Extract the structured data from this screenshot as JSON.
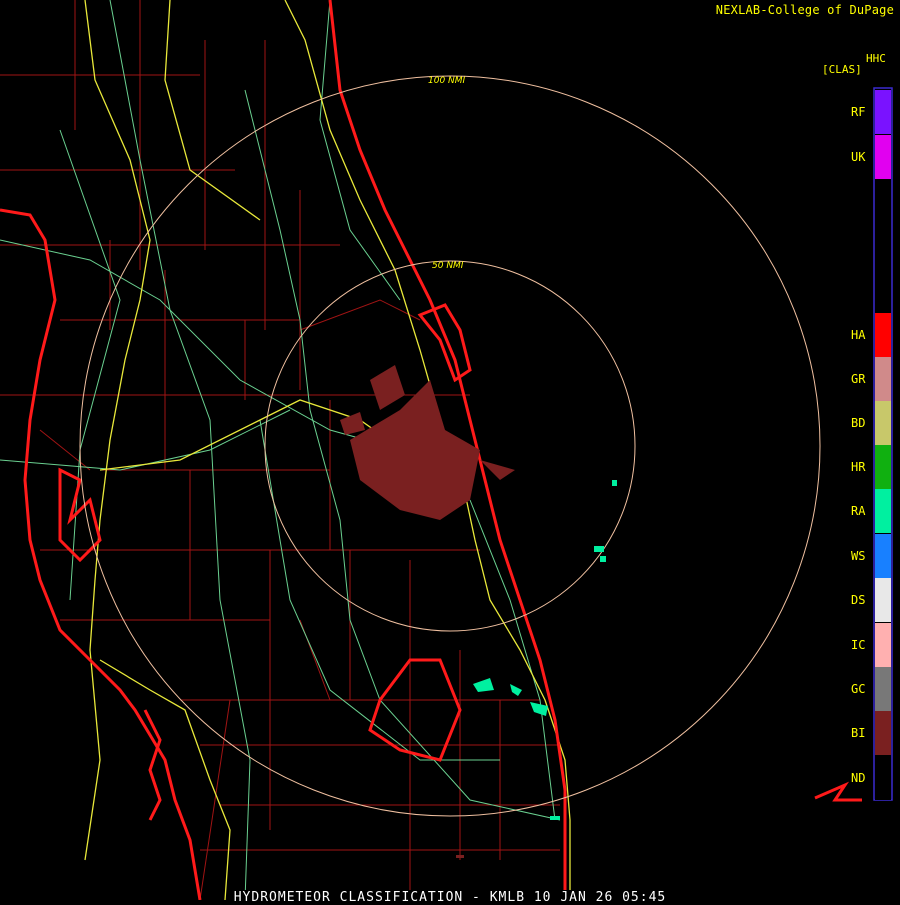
{
  "header": {
    "credit": "NEXLAB-College of DuPage"
  },
  "product": {
    "code": "HHC",
    "mode": "[CLAS]"
  },
  "range_rings": [
    {
      "label": "50 NMI"
    },
    {
      "label": "100 NMI"
    }
  ],
  "legend": [
    {
      "code": "RF",
      "color": "#7a12ff"
    },
    {
      "code": "UK",
      "color": "#e100f0"
    },
    {
      "code": "HA",
      "color": "#ff0000"
    },
    {
      "code": "GR",
      "color": "#d08a8a"
    },
    {
      "code": "BD",
      "color": "#c8c86a"
    },
    {
      "code": "HR",
      "color": "#10b010"
    },
    {
      "code": "RA",
      "color": "#00f0a0"
    },
    {
      "code": "WS",
      "color": "#1880ff"
    },
    {
      "code": "DS",
      "color": "#e8e8e8"
    },
    {
      "code": "IC",
      "color": "#ffb0b0"
    },
    {
      "code": "GC",
      "color": "#787878"
    },
    {
      "code": "BI",
      "color": "#7a2020"
    },
    {
      "code": "ND",
      "color": "#000000"
    }
  ],
  "footer": {
    "caption": "HYDROMETEOR CLASSIFICATION - KMLB 10 JAN 26 05:45"
  },
  "colors": {
    "coastline": "#ff1a1a",
    "county": "#b01818",
    "highway": "#ffff44",
    "road": "#7fe0a0",
    "ring": "#f0c0a0",
    "text": "#ffff00"
  }
}
